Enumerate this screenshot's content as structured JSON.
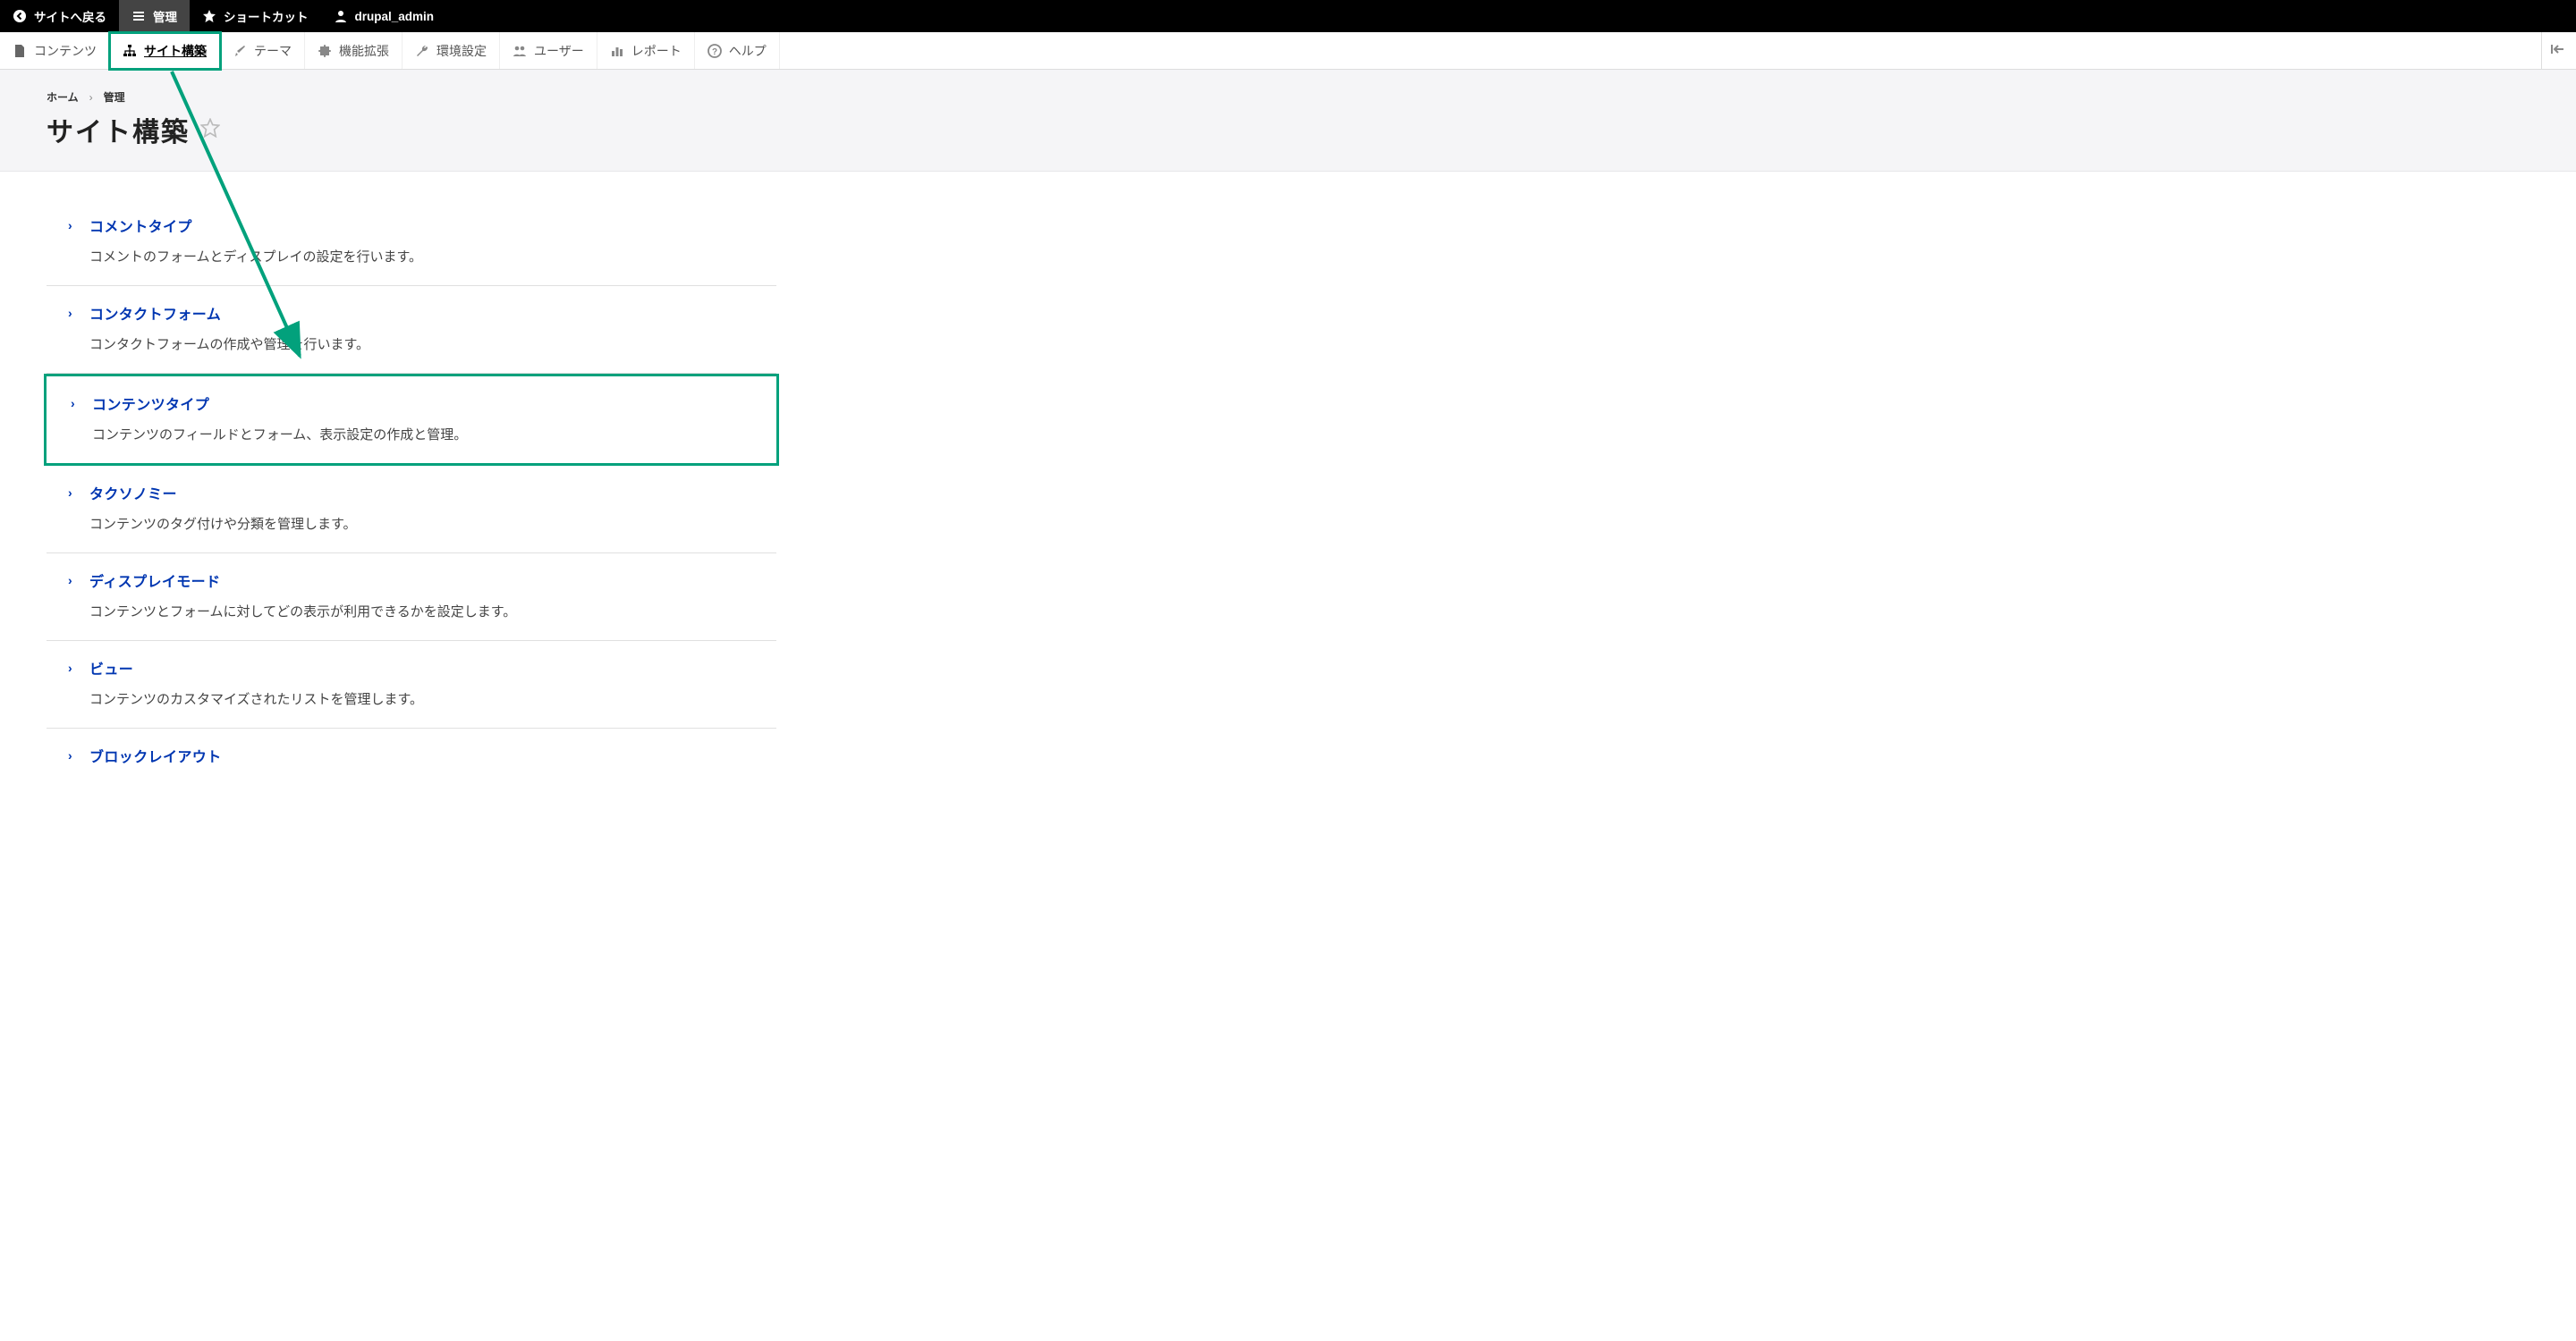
{
  "topbar": {
    "back_label": "サイトへ戻る",
    "manage_label": "管理",
    "shortcuts_label": "ショートカット",
    "user_label": "drupal_admin"
  },
  "toolbar": {
    "items": [
      {
        "label": "コンテンツ",
        "icon": "file-icon"
      },
      {
        "label": "サイト構築",
        "icon": "sitemap-icon",
        "active": true
      },
      {
        "label": "テーマ",
        "icon": "brush-icon"
      },
      {
        "label": "機能拡張",
        "icon": "puzzle-icon"
      },
      {
        "label": "環境設定",
        "icon": "wrench-icon"
      },
      {
        "label": "ユーザー",
        "icon": "users-icon"
      },
      {
        "label": "レポート",
        "icon": "chart-icon"
      },
      {
        "label": "ヘルプ",
        "icon": "help-icon"
      }
    ]
  },
  "breadcrumb": {
    "home": "ホーム",
    "admin": "管理"
  },
  "page_title": "サイト構築",
  "list": [
    {
      "title": "コメントタイプ",
      "desc": "コメントのフォームとディスプレイの設定を行います。"
    },
    {
      "title": "コンタクトフォーム",
      "desc": "コンタクトフォームの作成や管理を行います。"
    },
    {
      "title": "コンテンツタイプ",
      "desc": "コンテンツのフィールドとフォーム、表示設定の作成と管理。",
      "highlight": true
    },
    {
      "title": "タクソノミー",
      "desc": "コンテンツのタグ付けや分類を管理します。"
    },
    {
      "title": "ディスプレイモード",
      "desc": "コンテンツとフォームに対してどの表示が利用できるかを設定します。"
    },
    {
      "title": "ビュー",
      "desc": "コンテンツのカスタマイズされたリストを管理します。"
    },
    {
      "title": "ブロックレイアウト",
      "desc": ""
    }
  ],
  "annotation": {
    "color": "#02a17c",
    "arrow_from_toolbar_item": 1,
    "arrow_to_list_item": 2
  }
}
